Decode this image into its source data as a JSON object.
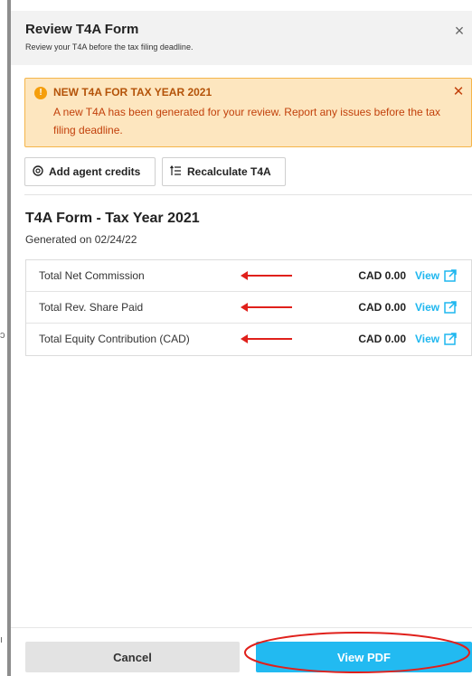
{
  "modal": {
    "title": "Review T4A Form",
    "subtitle": "Review your T4A before the tax filing deadline.",
    "close_symbol": "×"
  },
  "alert": {
    "icon": "!",
    "title": "NEW T4A FOR TAX YEAR 2021",
    "body": "A new T4A has been generated for your review. Report any issues before the tax filing deadline.",
    "close_symbol": "✕",
    "colors": {
      "background": "#fde6bf",
      "border": "#f5b54a",
      "text": "#c2410c"
    }
  },
  "actions": {
    "add_agent_credits": "Add agent credits",
    "recalculate": "Recalculate T4A"
  },
  "form": {
    "title": "T4A Form - Tax Year 2021",
    "generated": "Generated on 02/24/22"
  },
  "rows": [
    {
      "label": "Total Net Commission",
      "amount": "CAD 0.00",
      "view": "View"
    },
    {
      "label": "Total Rev. Share Paid",
      "amount": "CAD 0.00",
      "view": "View"
    },
    {
      "label": "Total Equity Contribution (CAD)",
      "amount": "CAD 0.00",
      "view": "View"
    }
  ],
  "footer": {
    "cancel": "Cancel",
    "view_pdf": "View PDF"
  },
  "colors": {
    "accent": "#22baf1",
    "annotation": "#e0201b"
  }
}
